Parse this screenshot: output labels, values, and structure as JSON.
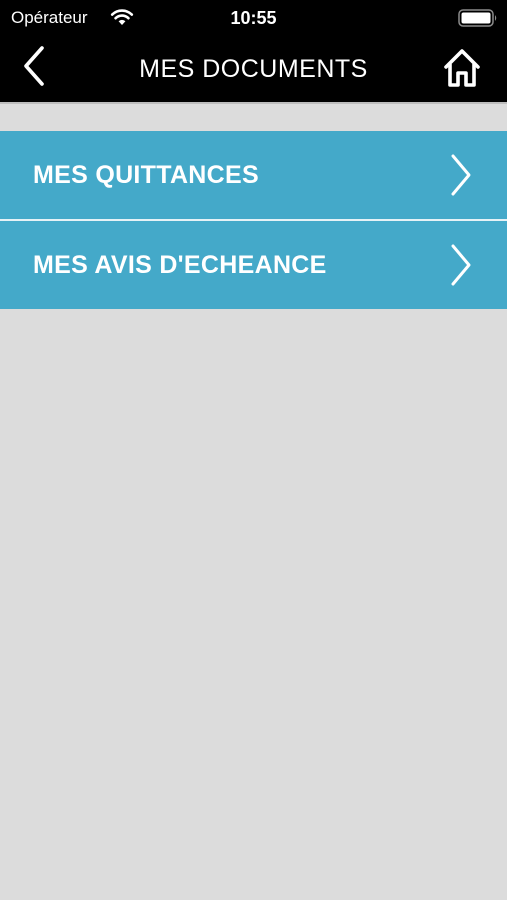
{
  "status_bar": {
    "carrier": "Opérateur",
    "time": "10:55"
  },
  "nav_bar": {
    "title": "MES DOCUMENTS",
    "back_icon": "chevron-left-icon",
    "home_icon": "home-icon"
  },
  "menu": {
    "items": [
      {
        "label": "MES QUITTANCES",
        "icon": "chevron-right-icon"
      },
      {
        "label": "MES AVIS D'ECHEANCE",
        "icon": "chevron-right-icon"
      }
    ]
  },
  "colors": {
    "status_bar_bg": "#000000",
    "nav_bar_bg": "#000000",
    "menu_item_bg": "#44a9c9",
    "page_bg": "#dcdcdc",
    "text_light": "#ffffff"
  }
}
